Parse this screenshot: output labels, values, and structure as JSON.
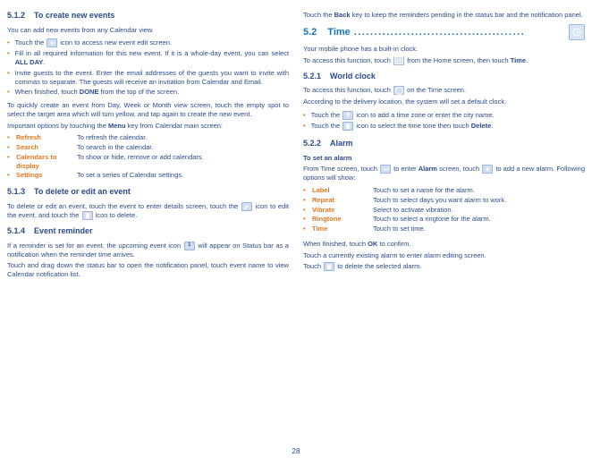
{
  "left": {
    "s512": {
      "num": "5.1.2",
      "title": "To create new events",
      "intro": "You can add new events from any Calendar view.",
      "b1a": "Touch the ",
      "b1b": " icon to access new event edit screen.",
      "b2a": "Fill in all required information for this new event. If it is a whole-day event, you can select ",
      "b2b": "ALL DAY",
      "b2c": ".",
      "b3": "Invite guests to the event. Enter the email addresses of the guests you want to invite with commas to separate. The guests will receive an invitation from Calendar and Email.",
      "b4a": "When finished, touch ",
      "b4b": "DONE",
      "b4c": " from the top of the screen.",
      "quick": "To quickly create an event from Day, Week or Month view screen, touch the empty spot to select the target area which will turn yellow, and tap again to create the new event.",
      "opts_intro": "Important options by touching the ",
      "menu": "Menu",
      "opts_intro2": " key from Calendar main screen:",
      "opts": [
        {
          "k": "Refresh",
          "v": "To refresh the calendar."
        },
        {
          "k": "Search",
          "v": "To search in the calendar."
        },
        {
          "k": "Calendars to display",
          "v": "To show or hide, remove or add calendars."
        },
        {
          "k": "Settings",
          "v": "To set a series of Calendar settings."
        }
      ]
    },
    "s513": {
      "num": "5.1.3",
      "title": "To delete or edit an event",
      "p1a": "To delete or edit an event, touch the event to enter details screen, touch  the ",
      "p1b": " icon to edit the event, and touch the ",
      "p1c": " icon to delete."
    },
    "s514": {
      "num": "5.1.4",
      "title": "Event reminder",
      "p1a": "If a reminder is set for an event, the upcoming event icon ",
      "p1b": " will appear on Status bar as a notification when the reminder time arrives.",
      "p2": "Touch and drag down the status bar to open the notification panel, touch event name to view Calendar notification list."
    }
  },
  "right": {
    "topa": "Touch the ",
    "topb": "Back",
    "topc": " key to keep the reminders pending in the status bar and the notification panel.",
    "s52": {
      "num": "5.2",
      "title": "Time",
      "p1": "Your mobile phone has a built-in clock.",
      "p2a": "To access this function, touch ",
      "p2b": " from the Home screen, then touch ",
      "p2c": "Time",
      "p2d": "."
    },
    "s521": {
      "num": "5.2.1",
      "title": "World clock",
      "p1a": "To access this function, touch ",
      "p1b": " on the Time screen.",
      "p2": "According to the delivery location, the system will set a default clock.",
      "b1a": "Touch the ",
      "b1b": " icon to add a time zone or enter the city name.",
      "b2a": "Touch the ",
      "b2b": " icon to select the time tone then touch ",
      "b2c": "Delete",
      "b2d": "."
    },
    "s522": {
      "num": "5.2.2",
      "title": "Alarm",
      "h": "To set an alarm",
      "p1a": "From Time screen, touch ",
      "p1b": " to enter ",
      "p1c": "Alarm",
      "p1d": " screen, touch ",
      "p1e": " to add a new alarm. Following options will show:",
      "opts": [
        {
          "k": "Label",
          "v": "Touch to set a name for the alarm."
        },
        {
          "k": "Repeat",
          "v": "Touch to select days you want alarm to work."
        },
        {
          "k": "Vibrate",
          "v": "Select to activate vibration."
        },
        {
          "k": "Ringtone",
          "v": "Touch to select a ringtone for the alarm."
        },
        {
          "k": "Time",
          "v": "Touch to set time."
        }
      ],
      "f1a": "When finished, touch ",
      "f1b": "OK",
      "f1c": " to confirm.",
      "f2": "Touch a currently existing alarm to enter alarm editing screen.",
      "f3a": "Touch ",
      "f3b": " to delete the selected alarm."
    }
  },
  "page": "28"
}
